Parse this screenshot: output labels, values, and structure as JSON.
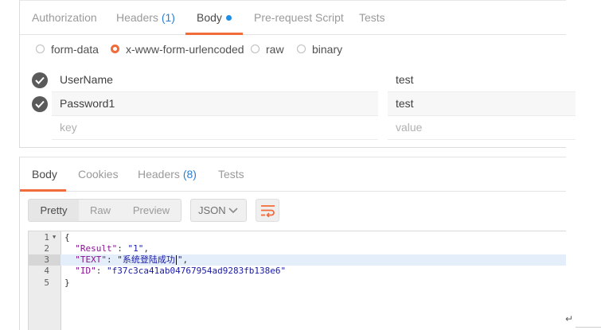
{
  "request": {
    "tabs": [
      {
        "label": "Authorization"
      },
      {
        "label": "Headers ",
        "count": "(1)"
      },
      {
        "label": "Body"
      },
      {
        "label": "Pre-request Script"
      },
      {
        "label": "Tests"
      }
    ],
    "body_modes": [
      "form-data",
      "x-www-form-urlencoded",
      "raw",
      "binary"
    ],
    "selected_body_mode": "x-www-form-urlencoded",
    "params": [
      {
        "key": "UserName",
        "value": "test",
        "enabled": true
      },
      {
        "key": "Password1",
        "value": "test",
        "enabled": true
      }
    ],
    "new_param": {
      "key_placeholder": "key",
      "value_placeholder": "value"
    }
  },
  "response": {
    "tabs": [
      {
        "label": "Body"
      },
      {
        "label": "Cookies"
      },
      {
        "label": "Headers ",
        "count": "(8)"
      },
      {
        "label": "Tests"
      }
    ],
    "view_modes": [
      "Pretty",
      "Raw",
      "Preview"
    ],
    "selected_view": "Pretty",
    "format": "JSON",
    "code": {
      "line_numbers": [
        "1",
        "2",
        "3",
        "4",
        "5"
      ],
      "open_brace": "{",
      "close_brace": "}",
      "fields": [
        {
          "key": "\"Result\"",
          "value": "\"1\"",
          "tail": ","
        },
        {
          "key": "\"TEXT\"",
          "value_before_cursor": "\"系统登陆成功",
          "value_after_cursor": "\"",
          "tail": ","
        },
        {
          "key": "\"ID\"",
          "value": "\"f37c3ca41ab04767954ad9283fb138e6\"",
          "tail": ""
        }
      ]
    }
  },
  "colors": {
    "accent": "#f26b3a",
    "count_blue": "#2a7fd4",
    "dot_blue": "#1c8ee6"
  }
}
